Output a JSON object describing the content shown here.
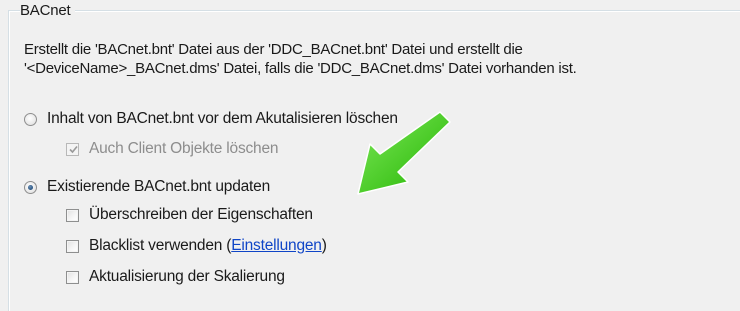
{
  "group": {
    "title": "BACnet",
    "description_line1": "Erstellt die 'BACnet.bnt' Datei aus der 'DDC_BACnet.bnt' Datei und erstellt die",
    "description_line2": "'<DeviceName>_BACnet.dms' Datei, falls die 'DDC_BACnet.dms' Datei vorhanden ist."
  },
  "options": {
    "radio_delete": {
      "label": "Inhalt von BACnet.bnt vor dem Akutalisieren löschen",
      "checked": false
    },
    "check_client_objects": {
      "label": "Auch Client Objekte löschen",
      "checked": true,
      "enabled": false
    },
    "radio_update": {
      "label": "Existierende BACnet.bnt updaten",
      "checked": true
    },
    "check_overwrite": {
      "label": "Überschreiben der Eigenschaften",
      "checked": false
    },
    "check_blacklist": {
      "label_before": "Blacklist verwenden (",
      "link": "Einstellungen",
      "label_after": ")",
      "checked": false
    },
    "check_scaling": {
      "label": "Aktualisierung der Skalierung",
      "checked": false
    }
  },
  "annotation": {
    "arrow_color": "#33cc00",
    "icon": "green-arrow-icon"
  }
}
